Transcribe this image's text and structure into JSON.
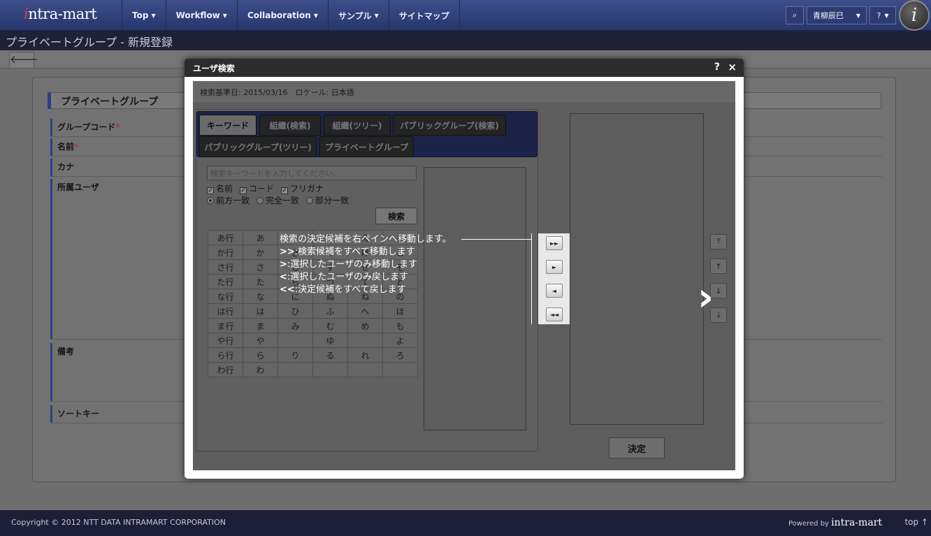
{
  "header": {
    "logo_text": "ntra-mart",
    "logo_initial": "i",
    "nav": [
      {
        "label": "Top"
      },
      {
        "label": "Workflow"
      },
      {
        "label": "Collaboration"
      },
      {
        "label": "サンプル"
      },
      {
        "label": "サイトマップ"
      }
    ],
    "user_name": "青柳辰巳",
    "help_label": "?",
    "search_icon": "search-icon",
    "brand_icon_letter": "i"
  },
  "page": {
    "title": "プライベートグループ - 新規登録",
    "back_icon": "arrow-left-icon",
    "section_title": "プライベートグループ",
    "fields": [
      {
        "label": "グループコード",
        "required": "*"
      },
      {
        "label": "名前",
        "required": "*"
      },
      {
        "label": "カナ",
        "required": ""
      },
      {
        "label": "所属ユーザ",
        "required": ""
      },
      {
        "label": "備考",
        "required": ""
      },
      {
        "label": "ソートキー",
        "required": ""
      }
    ]
  },
  "dialog": {
    "title": "ユーザ検索",
    "help": "?",
    "close": "×",
    "info": "検索基準日: 2015/03/16　ロケール: 日本語",
    "tabs": [
      "キーワード",
      "組織(検索)",
      "組織(ツリー)",
      "パブリックグループ(検索)",
      "パブリックグループ(ツリー)",
      "プライベートグループ"
    ],
    "keyword_placeholder": "検索キーワードを入力してください。",
    "checks": [
      "名前",
      "コード",
      "フリガナ"
    ],
    "radios": [
      "前方一致",
      "完全一致",
      "部分一致"
    ],
    "search_button": "検索",
    "kana_rows": [
      [
        "あ行",
        "あ",
        "い",
        "う",
        "え",
        "お"
      ],
      [
        "か行",
        "か",
        "き",
        "く",
        "け",
        "こ"
      ],
      [
        "さ行",
        "さ",
        "し",
        "す",
        "せ",
        "そ"
      ],
      [
        "た行",
        "た",
        "ち",
        "つ",
        "て",
        "と"
      ],
      [
        "な行",
        "な",
        "に",
        "ぬ",
        "ね",
        "の"
      ],
      [
        "は行",
        "は",
        "ひ",
        "ふ",
        "へ",
        "ほ"
      ],
      [
        "ま行",
        "ま",
        "み",
        "む",
        "め",
        "も"
      ],
      [
        "や行",
        "や",
        "",
        "ゆ",
        "",
        "よ"
      ],
      [
        "ら行",
        "ら",
        "り",
        "る",
        "れ",
        "ろ"
      ],
      [
        "わ行",
        "わ",
        "",
        "",
        "",
        ""
      ]
    ],
    "move_buttons": [
      "►►",
      "►",
      "◄",
      "◄◄"
    ],
    "sort_buttons": [
      "⤒",
      "↑",
      "↓",
      "⤓"
    ],
    "decide_button": "決定",
    "callout": {
      "line1": "検索の決定候補を右ペインへ移動します。",
      "line2_key": ">>",
      "line2": ":検索候補をすべて移動します",
      "line3_key": ">",
      "line3": ":選択したユーザのみ移動します",
      "line4_key": "<",
      "line4": ":選択したユーザのみ戻します",
      "line5_key": "<<",
      "line5": ":決定候補をすべて戻します"
    },
    "next_arrow": "›"
  },
  "footer": {
    "copyright": "Copyright © 2012 NTT DATA INTRAMART CORPORATION",
    "powered_by": "Powered by",
    "powered_brand": "intra-mart",
    "top_link": "top ↑"
  }
}
